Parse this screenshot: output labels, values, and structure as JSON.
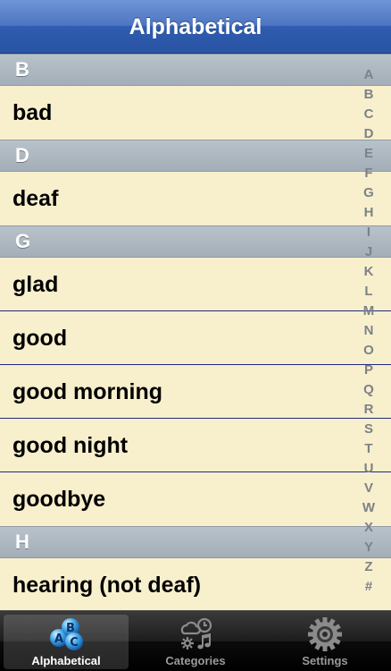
{
  "nav": {
    "title": "Alphabetical"
  },
  "sections": [
    {
      "header": "B",
      "items": [
        "bad"
      ]
    },
    {
      "header": "D",
      "items": [
        "deaf"
      ]
    },
    {
      "header": "G",
      "items": [
        "glad",
        "good",
        "good morning",
        "good night",
        "goodbye"
      ]
    },
    {
      "header": "H",
      "items": [
        "hearing (not deaf)"
      ]
    }
  ],
  "index": [
    "A",
    "B",
    "C",
    "D",
    "E",
    "F",
    "G",
    "H",
    "I",
    "J",
    "K",
    "L",
    "M",
    "N",
    "O",
    "P",
    "Q",
    "R",
    "S",
    "T",
    "U",
    "V",
    "W",
    "X",
    "Y",
    "Z",
    "#"
  ],
  "tabs": [
    {
      "label": "Alphabetical",
      "icon": "abc-bubbles-icon",
      "selected": true
    },
    {
      "label": "Categories",
      "icon": "categories-icon",
      "selected": false
    },
    {
      "label": "Settings",
      "icon": "gear-icon",
      "selected": false
    }
  ],
  "colors": {
    "nav_bar": "#4d75c1",
    "row_background": "#f8efcd",
    "section_header": "#a3aeb8",
    "row_separator": "#1f2b7a",
    "index_text": "#7d8287",
    "tab_bar": "#111111"
  }
}
